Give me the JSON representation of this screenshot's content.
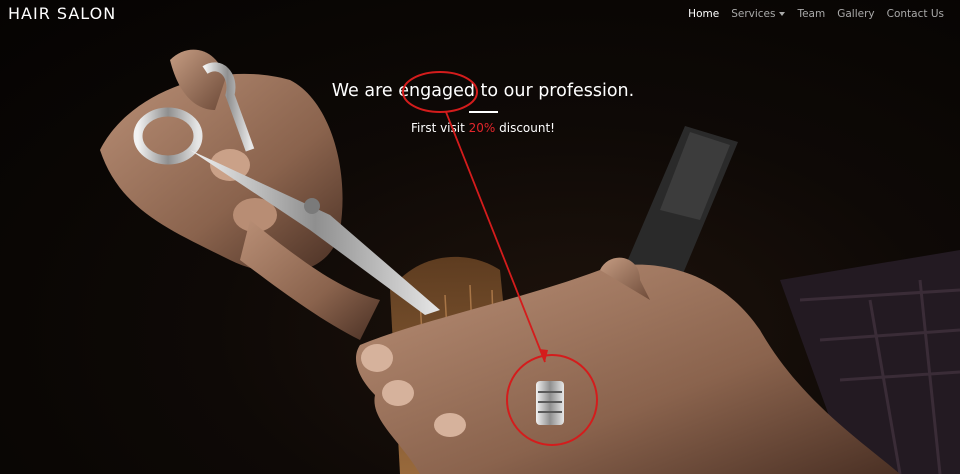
{
  "brand": "HAIR SALON",
  "nav": {
    "home": "Home",
    "services": "Services",
    "team": "Team",
    "gallery": "Gallery",
    "contact": "Contact Us"
  },
  "hero": {
    "headline_before": "We are ",
    "headline_highlight": "engaged",
    "headline_after": " to our profession.",
    "sub_before": "First visit ",
    "sub_discount": "20%",
    "sub_after": " discount!"
  },
  "colors": {
    "accent_red": "#e3262b",
    "annotation_red": "#d41c1c",
    "nav_active": "#ffffff",
    "nav_inactive": "#a9a9a9"
  }
}
